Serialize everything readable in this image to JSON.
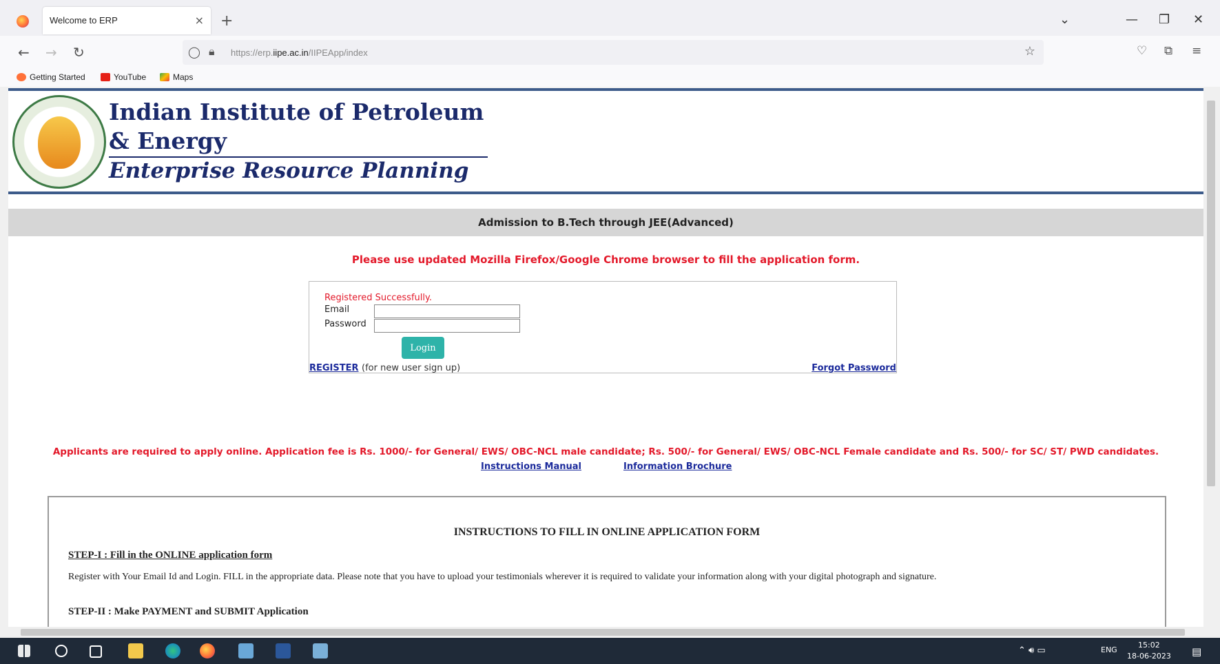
{
  "browser": {
    "tab_title": "Welcome to ERP",
    "tab_close": "×",
    "new_tab": "+",
    "url_prefix": "https://erp.",
    "url_domain": "iipe.ac.in",
    "url_suffix": "/IIPEApp/index",
    "bookmarks": [
      "Getting Started",
      "YouTube",
      "Maps"
    ]
  },
  "header": {
    "title_line1": "Indian Institute of Petroleum",
    "title_line2": "& Energy",
    "subtitle": "Enterprise Resource Planning"
  },
  "band_title": "Admission to B.Tech through JEE(Advanced)",
  "browser_note": "Please use updated Mozilla Firefox/Google Chrome browser to fill the application form.",
  "login": {
    "message": "Registered Successfully.",
    "email_label": "Email",
    "password_label": "Password",
    "login_button": "Login",
    "register_link": "REGISTER",
    "register_note": "(for new user sign up)",
    "forgot_link": "Forgot Password"
  },
  "fee_note": "Applicants are required to apply online. Application fee is Rs. 1000/- for General/ EWS/ OBC-NCL male candidate; Rs. 500/- for General/ EWS/ OBC-NCL Female candidate and Rs. 500/- for SC/ ST/ PWD candidates.",
  "links": {
    "instructions_manual": "Instructions Manual",
    "information_brochure": "Information Brochure"
  },
  "instructions": {
    "title": "INSTRUCTIONS TO FILL IN ONLINE APPLICATION FORM",
    "step1_title": "STEP-I : Fill in the ONLINE application form",
    "step1_text": "Register with Your Email Id and Login. FILL in the appropriate data. Please note that you have to upload your testimonials wherever it is required to validate your information along with your digital photograph and signature.",
    "step2_title": "STEP-II : Make PAYMENT and SUBMIT Application"
  },
  "taskbar": {
    "lang": "ENG",
    "time": "15:02",
    "date": "18-06-2023"
  }
}
